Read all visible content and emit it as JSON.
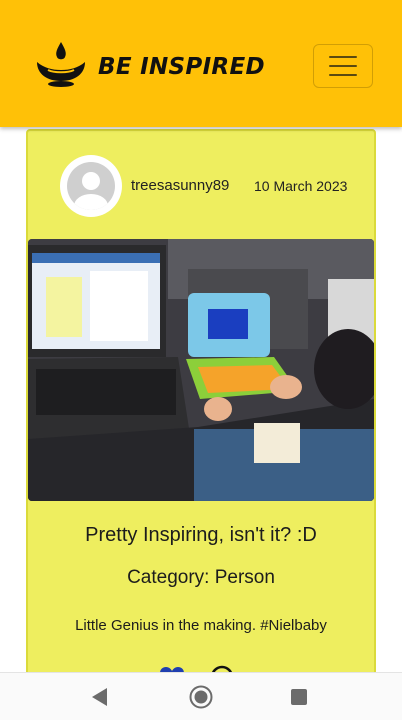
{
  "header": {
    "brand_title": "BE INSPIRED",
    "logo_icon": "diya-lamp-icon",
    "menu_icon": "hamburger-menu-icon",
    "background_color": "#FFC107"
  },
  "post": {
    "author": "treesasunny89",
    "date": "10 March 2023",
    "avatar_icon": "default-avatar-icon",
    "image_description_icon": "post-photo",
    "title": "Pretty Inspiring, isn't it? :D",
    "category": "Category: Person",
    "description": "Little Genius in the making. #Nielbaby",
    "like_icon": "heart-icon",
    "comment_icon": "comment-icon",
    "card_color": "#EEEE5F"
  },
  "system_nav": {
    "back_icon": "back-triangle-icon",
    "home_icon": "home-circle-icon",
    "recent_icon": "recent-apps-square-icon"
  }
}
